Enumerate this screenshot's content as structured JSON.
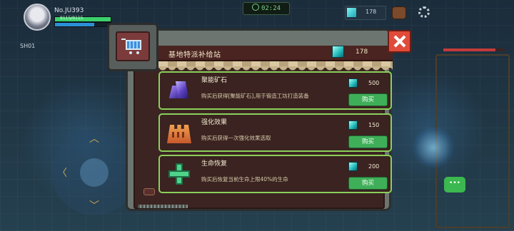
{
  "hud": {
    "player_id": "No.JU393",
    "hp_text": "9115/9115",
    "hp_fraction": 1.0,
    "sp_fraction": 0.7,
    "timer": "02:24",
    "top_currency": "178",
    "side_label": "SH01",
    "enemy_hp_fraction": 0.85
  },
  "shop": {
    "title": "基地特派补给站",
    "currency_amount": "178",
    "items": [
      {
        "icon": "purple-crystal-icon",
        "name": "聚能矿石",
        "description": "购买后获得[聚能矿石],用于锻造工坊打造装备",
        "price": "500",
        "buy_label": "购买"
      },
      {
        "icon": "orange-tower-icon",
        "name": "强化效果",
        "description": "购买后获得一次强化效果选取",
        "price": "150",
        "buy_label": "购买"
      },
      {
        "icon": "green-cross-icon",
        "name": "生命恢复",
        "description": "购买后恢复当前生命上限40%的生命",
        "price": "200",
        "buy_label": "购买"
      }
    ]
  },
  "colors": {
    "row_border": "#8bd05a",
    "buy_button": "#3fae58",
    "close_button": "#e04b3a",
    "title_bar": "#4a2420"
  }
}
